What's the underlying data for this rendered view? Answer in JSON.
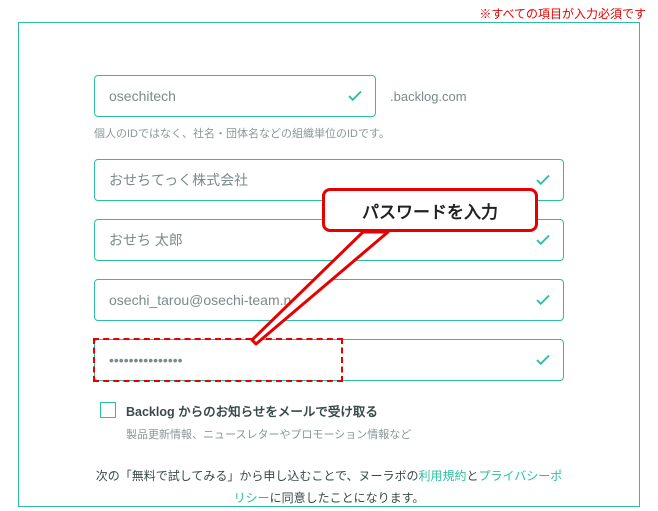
{
  "required_note": "※すべての項目が入力必須です",
  "fields": {
    "space_id": {
      "value": "osechitech",
      "suffix": ".backlog.com",
      "helper": "個人のIDではなく、社名・団体名などの組織単位のIDです。"
    },
    "org_name": {
      "value": "おせちてっく株式会社"
    },
    "user_name": {
      "value": "おせち 太郎"
    },
    "email": {
      "value": "osechi_tarou@osechi-team.net"
    },
    "password": {
      "value": "***************"
    }
  },
  "callout": {
    "text": "パスワードを入力"
  },
  "newsletter": {
    "label": "Backlog からのお知らせをメールで受け取る",
    "sub": "製品更新情報、ニュースレターやプロモーション情報など"
  },
  "terms": {
    "pre": "次の「無料で試してみる」から申し込むことで、ヌーラボの",
    "link1": "利用規約",
    "mid": "と",
    "link2": "プライバシーポリシー",
    "post": "に同意したことになります。"
  }
}
